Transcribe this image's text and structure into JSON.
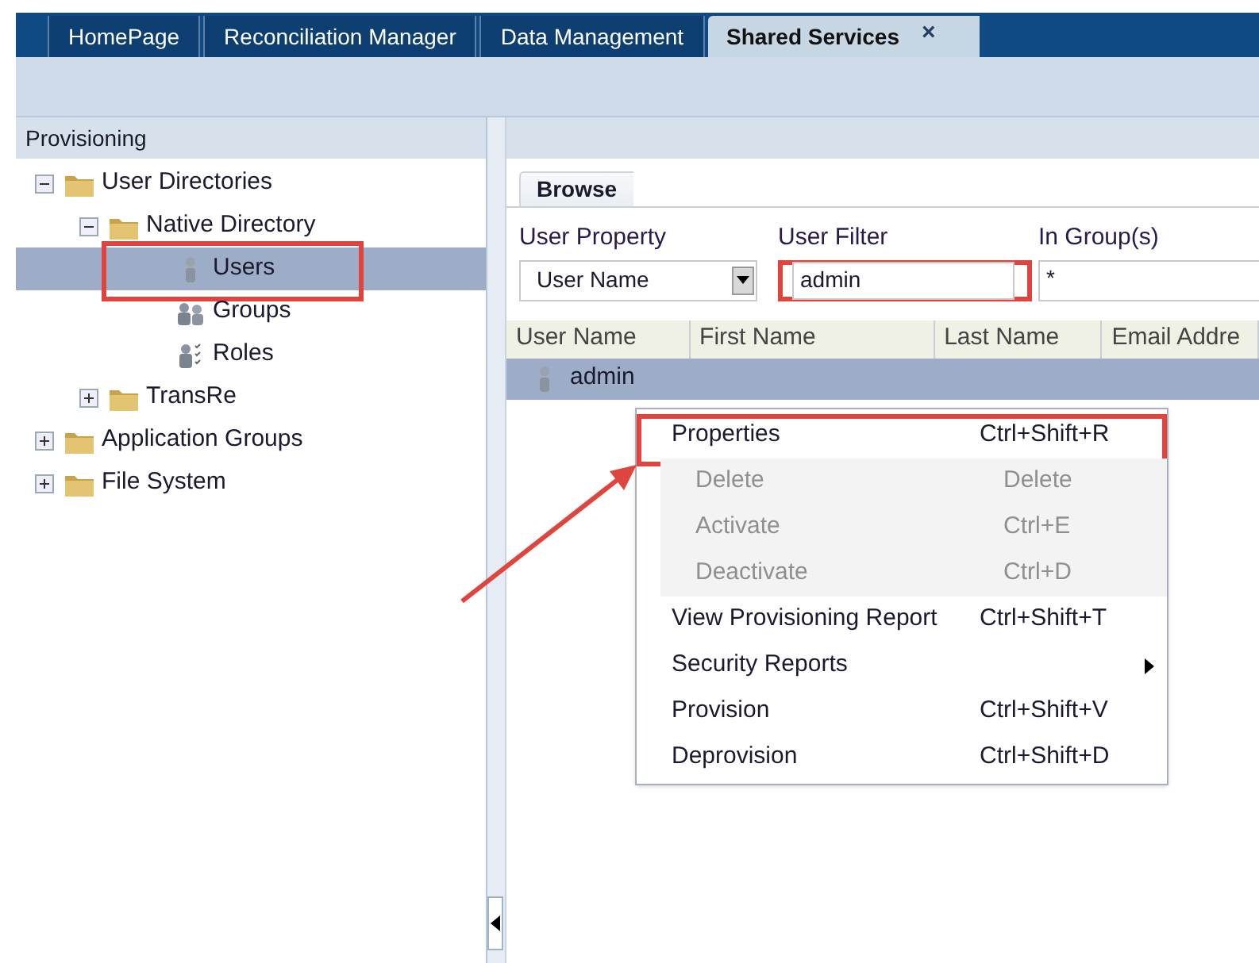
{
  "tabs": [
    {
      "label": "HomePage",
      "selected": false
    },
    {
      "label": "Reconciliation Manager",
      "selected": false
    },
    {
      "label": "Data Management",
      "selected": false
    },
    {
      "label": "Shared Services",
      "selected": true,
      "close_glyph": "×"
    }
  ],
  "sidebar": {
    "title": "Provisioning",
    "tree": [
      {
        "label": "User Directories",
        "kind": "folder",
        "expanded": true,
        "selected": false,
        "highlighted": false,
        "children": [
          {
            "label": "Native Directory",
            "kind": "folder",
            "expanded": true,
            "selected": false,
            "highlighted": false,
            "children": [
              {
                "label": "Users",
                "kind": "user",
                "selected": true,
                "highlighted": true
              },
              {
                "label": "Groups",
                "kind": "group",
                "selected": false,
                "highlighted": false
              },
              {
                "label": "Roles",
                "kind": "role",
                "selected": false,
                "highlighted": false
              }
            ]
          },
          {
            "label": "TransRe",
            "kind": "folder",
            "expanded": false,
            "selected": false,
            "highlighted": false
          }
        ]
      },
      {
        "label": "Application Groups",
        "kind": "folder",
        "expanded": false,
        "selected": false,
        "highlighted": false
      },
      {
        "label": "File System",
        "kind": "folder",
        "expanded": false,
        "selected": false,
        "highlighted": false
      }
    ]
  },
  "browse": {
    "tab": "Browse",
    "user_property": {
      "label": "User Property",
      "value": "User Name"
    },
    "user_filter": {
      "label": "User Filter",
      "value": "admin",
      "highlighted": true
    },
    "in_groups": {
      "label": "In Group(s)",
      "value": "*"
    },
    "table": {
      "columns": [
        "User Name",
        "First Name",
        "Last Name",
        "Email Addre"
      ],
      "rows": [
        {
          "user_name": "admin",
          "selected": true
        }
      ]
    }
  },
  "context_menu": [
    {
      "label": "Properties",
      "shortcut": "Ctrl+Shift+R",
      "disabled": false,
      "highlighted": true,
      "submenu": false
    },
    {
      "label": "Delete",
      "shortcut": "Delete",
      "disabled": true,
      "highlighted": false,
      "submenu": false
    },
    {
      "label": "Activate",
      "shortcut": "Ctrl+E",
      "disabled": true,
      "highlighted": false,
      "submenu": false
    },
    {
      "label": "Deactivate",
      "shortcut": "Ctrl+D",
      "disabled": true,
      "highlighted": false,
      "submenu": false
    },
    {
      "label": "View Provisioning Report",
      "shortcut": "Ctrl+Shift+T",
      "disabled": false,
      "highlighted": false,
      "submenu": false
    },
    {
      "label": "Security Reports",
      "disabled": false,
      "highlighted": false,
      "submenu": true
    },
    {
      "label": "Provision",
      "shortcut": "Ctrl+Shift+V",
      "disabled": false,
      "highlighted": false,
      "submenu": false
    },
    {
      "label": "Deprovision",
      "shortcut": "Ctrl+Shift+D",
      "disabled": false,
      "highlighted": false,
      "submenu": false
    }
  ]
}
